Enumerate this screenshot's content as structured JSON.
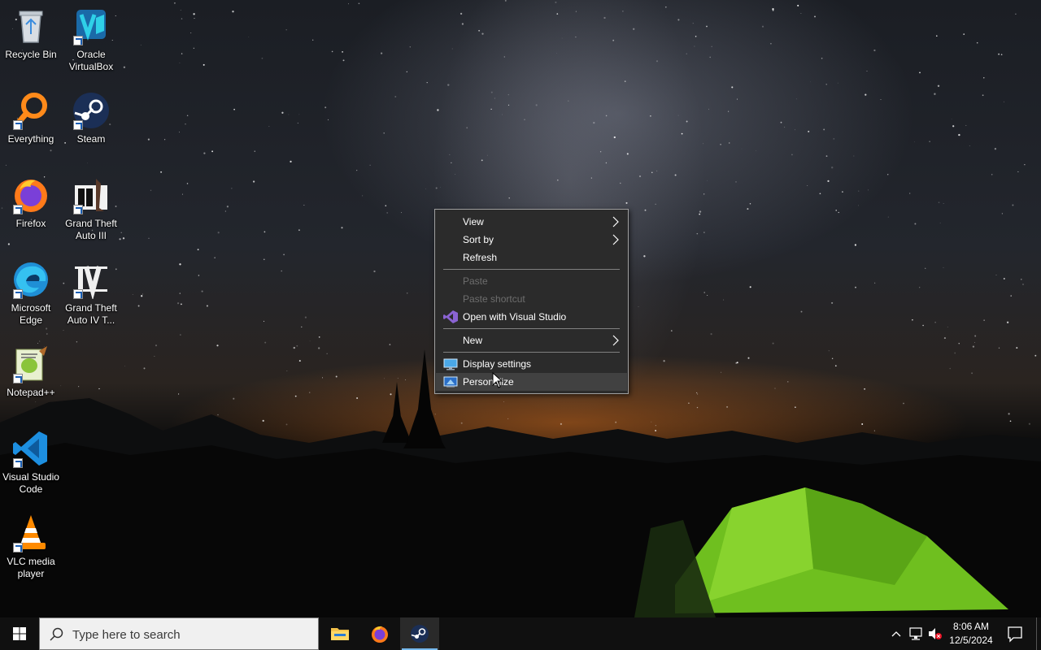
{
  "desktop": {
    "icons": [
      {
        "label": "Recycle Bin",
        "icon": "recycle-bin-icon"
      },
      {
        "label": "Oracle VirtualBox",
        "icon": "virtualbox-icon"
      },
      {
        "label": "Everything",
        "icon": "everything-search-icon"
      },
      {
        "label": "Steam",
        "icon": "steam-icon"
      },
      {
        "label": "Firefox",
        "icon": "firefox-icon"
      },
      {
        "label": "Grand Theft Auto III",
        "icon": "gta3-icon"
      },
      {
        "label": "Microsoft Edge",
        "icon": "edge-icon"
      },
      {
        "label": "Grand Theft Auto IV T...",
        "icon": "gta4-icon"
      },
      {
        "label": "Notepad++",
        "icon": "notepadpp-icon"
      },
      {
        "label": "Visual Studio Code",
        "icon": "vscode-icon"
      },
      {
        "label": "VLC media player",
        "icon": "vlc-icon"
      }
    ]
  },
  "context_menu": {
    "items": [
      {
        "label": "View",
        "submenu": true,
        "enabled": true
      },
      {
        "label": "Sort by",
        "submenu": true,
        "enabled": true
      },
      {
        "label": "Refresh",
        "submenu": false,
        "enabled": true
      },
      {
        "label": "Paste",
        "submenu": false,
        "enabled": false
      },
      {
        "label": "Paste shortcut",
        "submenu": false,
        "enabled": false
      },
      {
        "label": "Open with Visual Studio",
        "submenu": false,
        "enabled": true,
        "icon": "visual-studio-icon"
      },
      {
        "label": "New",
        "submenu": true,
        "enabled": true
      },
      {
        "label": "Display settings",
        "submenu": false,
        "enabled": true,
        "icon": "display-icon"
      },
      {
        "label": "Personalize",
        "submenu": false,
        "enabled": true,
        "icon": "personalize-icon",
        "hovered": true
      }
    ]
  },
  "taskbar": {
    "search_placeholder": "Type here to search",
    "pinned": [
      {
        "name": "File Explorer",
        "icon": "file-explorer-icon",
        "active": false
      },
      {
        "name": "Firefox",
        "icon": "firefox-icon",
        "active": false
      },
      {
        "name": "Steam",
        "icon": "steam-icon",
        "active": true
      }
    ],
    "tray": {
      "time": "8:06 AM",
      "date": "12/5/2024"
    }
  },
  "colors": {
    "menu_bg": "#2b2b2b",
    "taskbar_bg": "#101010",
    "accent": "#76b9ed"
  }
}
